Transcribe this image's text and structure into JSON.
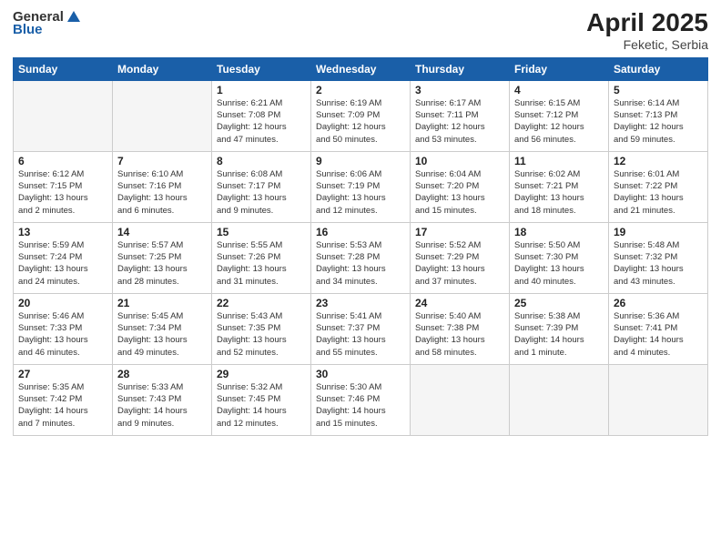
{
  "logo": {
    "text_general": "General",
    "text_blue": "Blue"
  },
  "title": {
    "month": "April 2025",
    "location": "Feketic, Serbia"
  },
  "weekdays": [
    "Sunday",
    "Monday",
    "Tuesday",
    "Wednesday",
    "Thursday",
    "Friday",
    "Saturday"
  ],
  "weeks": [
    [
      {
        "day": "",
        "info": ""
      },
      {
        "day": "",
        "info": ""
      },
      {
        "day": "1",
        "info": "Sunrise: 6:21 AM\nSunset: 7:08 PM\nDaylight: 12 hours\nand 47 minutes."
      },
      {
        "day": "2",
        "info": "Sunrise: 6:19 AM\nSunset: 7:09 PM\nDaylight: 12 hours\nand 50 minutes."
      },
      {
        "day": "3",
        "info": "Sunrise: 6:17 AM\nSunset: 7:11 PM\nDaylight: 12 hours\nand 53 minutes."
      },
      {
        "day": "4",
        "info": "Sunrise: 6:15 AM\nSunset: 7:12 PM\nDaylight: 12 hours\nand 56 minutes."
      },
      {
        "day": "5",
        "info": "Sunrise: 6:14 AM\nSunset: 7:13 PM\nDaylight: 12 hours\nand 59 minutes."
      }
    ],
    [
      {
        "day": "6",
        "info": "Sunrise: 6:12 AM\nSunset: 7:15 PM\nDaylight: 13 hours\nand 2 minutes."
      },
      {
        "day": "7",
        "info": "Sunrise: 6:10 AM\nSunset: 7:16 PM\nDaylight: 13 hours\nand 6 minutes."
      },
      {
        "day": "8",
        "info": "Sunrise: 6:08 AM\nSunset: 7:17 PM\nDaylight: 13 hours\nand 9 minutes."
      },
      {
        "day": "9",
        "info": "Sunrise: 6:06 AM\nSunset: 7:19 PM\nDaylight: 13 hours\nand 12 minutes."
      },
      {
        "day": "10",
        "info": "Sunrise: 6:04 AM\nSunset: 7:20 PM\nDaylight: 13 hours\nand 15 minutes."
      },
      {
        "day": "11",
        "info": "Sunrise: 6:02 AM\nSunset: 7:21 PM\nDaylight: 13 hours\nand 18 minutes."
      },
      {
        "day": "12",
        "info": "Sunrise: 6:01 AM\nSunset: 7:22 PM\nDaylight: 13 hours\nand 21 minutes."
      }
    ],
    [
      {
        "day": "13",
        "info": "Sunrise: 5:59 AM\nSunset: 7:24 PM\nDaylight: 13 hours\nand 24 minutes."
      },
      {
        "day": "14",
        "info": "Sunrise: 5:57 AM\nSunset: 7:25 PM\nDaylight: 13 hours\nand 28 minutes."
      },
      {
        "day": "15",
        "info": "Sunrise: 5:55 AM\nSunset: 7:26 PM\nDaylight: 13 hours\nand 31 minutes."
      },
      {
        "day": "16",
        "info": "Sunrise: 5:53 AM\nSunset: 7:28 PM\nDaylight: 13 hours\nand 34 minutes."
      },
      {
        "day": "17",
        "info": "Sunrise: 5:52 AM\nSunset: 7:29 PM\nDaylight: 13 hours\nand 37 minutes."
      },
      {
        "day": "18",
        "info": "Sunrise: 5:50 AM\nSunset: 7:30 PM\nDaylight: 13 hours\nand 40 minutes."
      },
      {
        "day": "19",
        "info": "Sunrise: 5:48 AM\nSunset: 7:32 PM\nDaylight: 13 hours\nand 43 minutes."
      }
    ],
    [
      {
        "day": "20",
        "info": "Sunrise: 5:46 AM\nSunset: 7:33 PM\nDaylight: 13 hours\nand 46 minutes."
      },
      {
        "day": "21",
        "info": "Sunrise: 5:45 AM\nSunset: 7:34 PM\nDaylight: 13 hours\nand 49 minutes."
      },
      {
        "day": "22",
        "info": "Sunrise: 5:43 AM\nSunset: 7:35 PM\nDaylight: 13 hours\nand 52 minutes."
      },
      {
        "day": "23",
        "info": "Sunrise: 5:41 AM\nSunset: 7:37 PM\nDaylight: 13 hours\nand 55 minutes."
      },
      {
        "day": "24",
        "info": "Sunrise: 5:40 AM\nSunset: 7:38 PM\nDaylight: 13 hours\nand 58 minutes."
      },
      {
        "day": "25",
        "info": "Sunrise: 5:38 AM\nSunset: 7:39 PM\nDaylight: 14 hours\nand 1 minute."
      },
      {
        "day": "26",
        "info": "Sunrise: 5:36 AM\nSunset: 7:41 PM\nDaylight: 14 hours\nand 4 minutes."
      }
    ],
    [
      {
        "day": "27",
        "info": "Sunrise: 5:35 AM\nSunset: 7:42 PM\nDaylight: 14 hours\nand 7 minutes."
      },
      {
        "day": "28",
        "info": "Sunrise: 5:33 AM\nSunset: 7:43 PM\nDaylight: 14 hours\nand 9 minutes."
      },
      {
        "day": "29",
        "info": "Sunrise: 5:32 AM\nSunset: 7:45 PM\nDaylight: 14 hours\nand 12 minutes."
      },
      {
        "day": "30",
        "info": "Sunrise: 5:30 AM\nSunset: 7:46 PM\nDaylight: 14 hours\nand 15 minutes."
      },
      {
        "day": "",
        "info": ""
      },
      {
        "day": "",
        "info": ""
      },
      {
        "day": "",
        "info": ""
      }
    ]
  ]
}
